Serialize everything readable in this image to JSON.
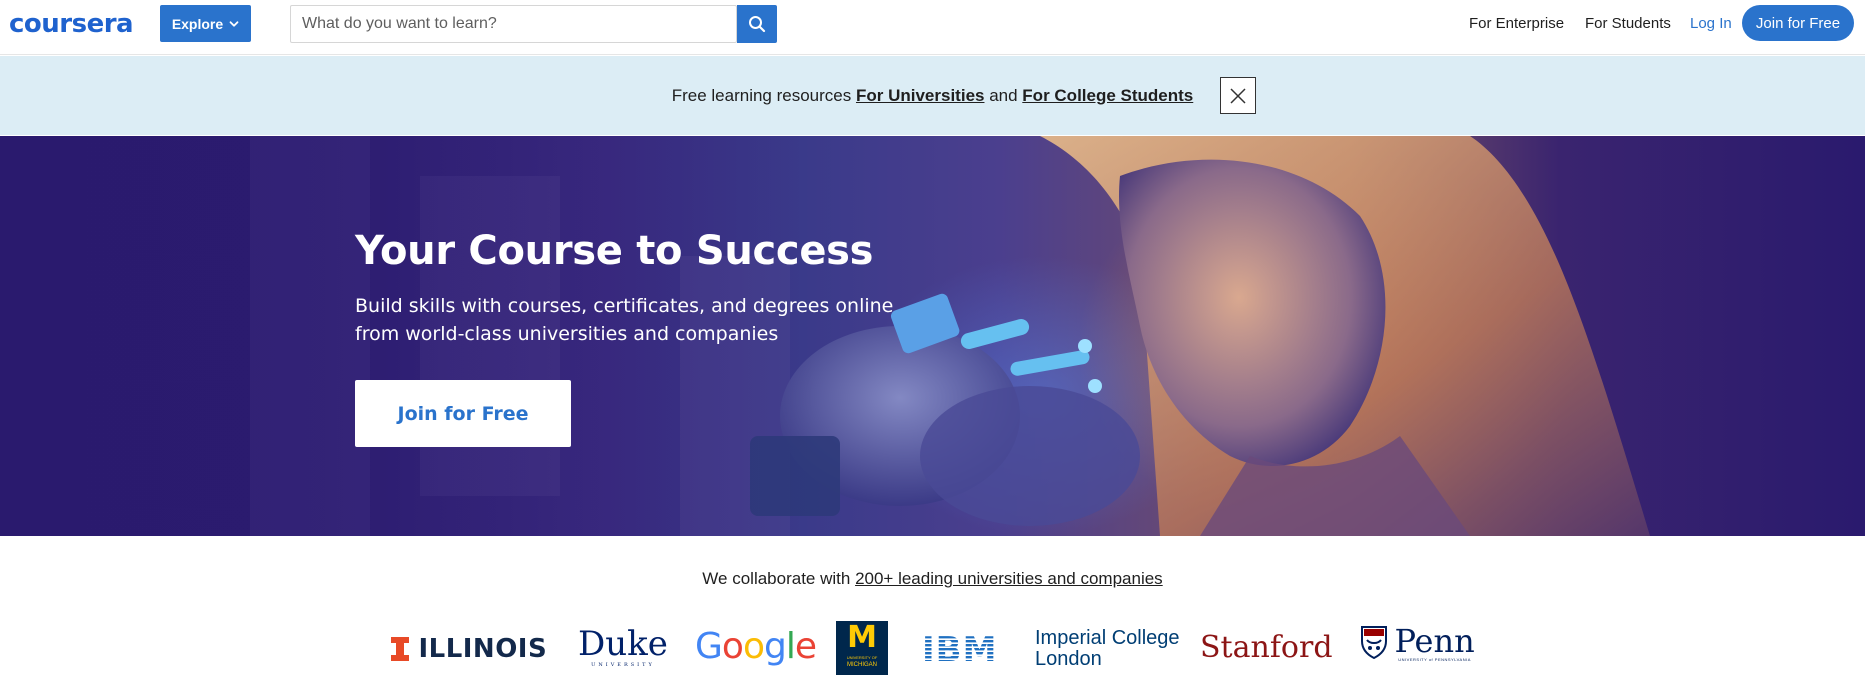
{
  "header": {
    "logo": "coursera",
    "explore_label": "Explore",
    "search": {
      "placeholder": "What do you want to learn?"
    },
    "nav": {
      "enterprise": "For Enterprise",
      "students": "For Students",
      "login": "Log In",
      "join": "Join for Free"
    }
  },
  "banner": {
    "prefix": "Free learning resources ",
    "link_universities": "For Universities",
    "middle": " and ",
    "link_students": "For College Students"
  },
  "hero": {
    "title": "Your Course to Success",
    "subtitle": "Build skills with courses, certificates, and degrees online from world-class universities and companies",
    "join_label": "Join for Free"
  },
  "partners": {
    "prefix": "We collaborate with ",
    "link": "200+ leading universities and companies",
    "logos": {
      "illinois": "ILLINOIS",
      "duke": "Duke",
      "duke_sub": "UNIVERSITY",
      "google": [
        "G",
        "o",
        "o",
        "g",
        "l",
        "e"
      ],
      "michigan": "M",
      "michigan_sub1": "UNIVERSITY OF",
      "michigan_sub2": "MICHIGAN",
      "ibm": "IBM",
      "imperial_line1": "Imperial College",
      "imperial_line2": "London",
      "stanford": "Stanford",
      "penn": "Penn",
      "penn_sub": "UNIVERSITY of PENNSYLVANIA"
    }
  },
  "colors": {
    "brand_blue": "#2a73cc",
    "hero_purple": "#2a1a6e",
    "banner_bg": "#dcedf5",
    "illinois_orange": "#e84a27",
    "illinois_navy": "#13294b",
    "duke_navy": "#012169",
    "michigan_blue": "#00274c",
    "michigan_maize": "#ffcb05",
    "ibm_blue": "#1f70c1",
    "imperial_navy": "#003e74",
    "stanford_red": "#8c1515",
    "penn_navy": "#011f5b"
  },
  "icons": {
    "explore": "chevron-down-icon",
    "search": "search-icon",
    "close": "close-icon"
  }
}
